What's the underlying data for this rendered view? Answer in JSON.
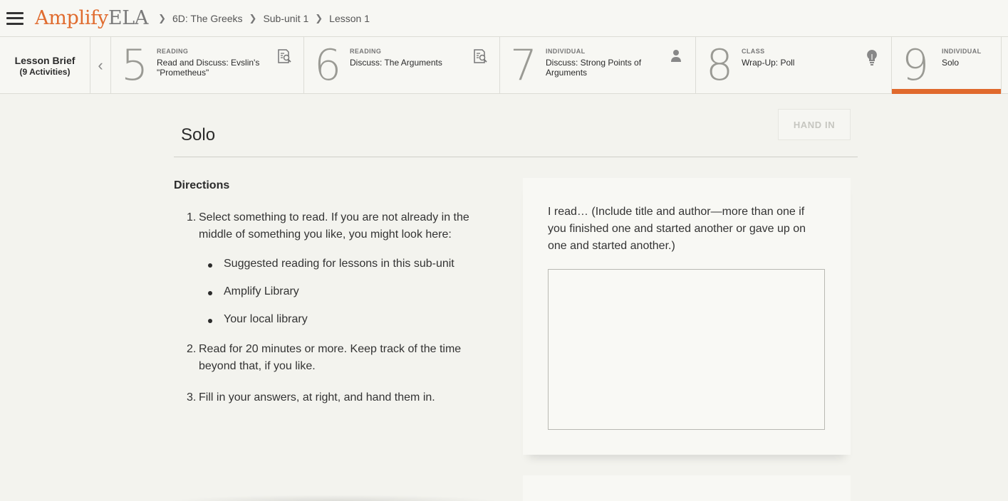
{
  "topbar": {
    "logo_amplify": "Amplify",
    "logo_ela": "ELA",
    "breadcrumbs": [
      "6D: The Greeks",
      "Sub-unit 1",
      "Lesson 1"
    ]
  },
  "lesson_brief": {
    "title": "Lesson Brief",
    "subtitle": "(9 Activities)"
  },
  "activities": [
    {
      "number": "5",
      "type": "READING",
      "title": "Read and Discuss: Evslin's \"Prometheus\"",
      "icon": "reading-icon"
    },
    {
      "number": "6",
      "type": "READING",
      "title": "Discuss: The Arguments",
      "icon": "reading-icon"
    },
    {
      "number": "7",
      "type": "INDIVIDUAL",
      "title": "Discuss: Strong Points of Arguments",
      "icon": "person-icon"
    },
    {
      "number": "8",
      "type": "CLASS",
      "title": "Wrap-Up: Poll",
      "icon": "lightbulb-icon"
    },
    {
      "number": "9",
      "type": "INDIVIDUAL",
      "title": "Solo",
      "icon": "",
      "active": true
    }
  ],
  "main": {
    "title": "Solo",
    "hand_in_label": "HAND IN",
    "directions_heading": "Directions",
    "steps": [
      {
        "num": "1.",
        "text": "Select something to read. If you are not already in the middle of something you like, you might look here:"
      },
      {
        "num": "2.",
        "text": "Read for 20 minutes or more. Keep track of the time beyond that, if you like."
      },
      {
        "num": "3.",
        "text": "Fill in your answers, at right, and hand them in."
      }
    ],
    "bullets": [
      "Suggested reading for lessons in this sub-unit",
      "Amplify Library",
      "Your local library"
    ],
    "prompt": "I read… (Include title and author—more than one if you finished one and started another or gave up on one and started another.)",
    "answer_value": ""
  },
  "colors": {
    "accent": "#e0692c",
    "logo_orange": "#e06b2e"
  }
}
